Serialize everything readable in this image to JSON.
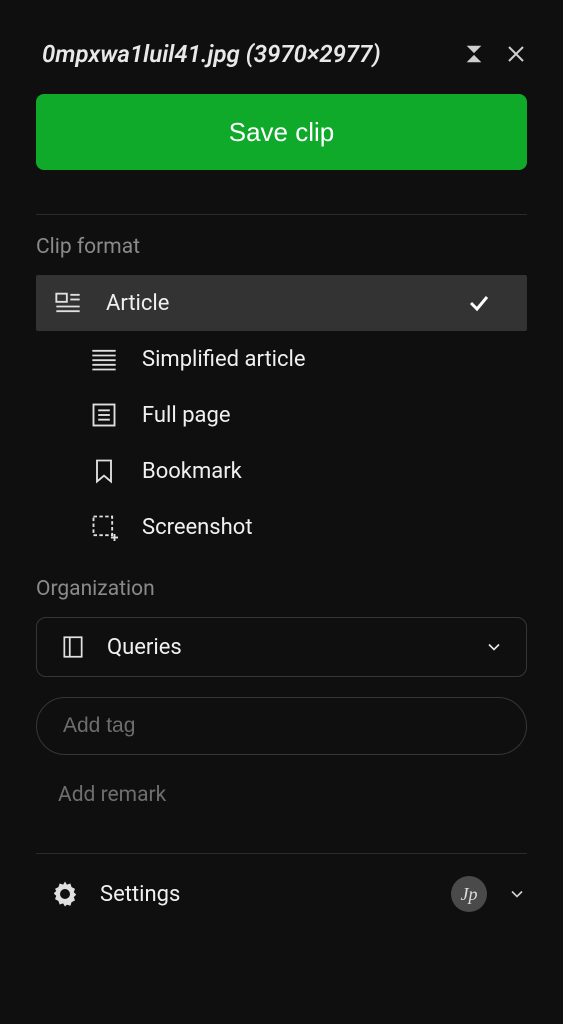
{
  "header": {
    "title": "0mpxwa1luil41.jpg (3970×2977)"
  },
  "save_button_label": "Save clip",
  "clip_format": {
    "section_label": "Clip format",
    "items": [
      {
        "label": "Article",
        "icon": "article",
        "selected": true
      },
      {
        "label": "Simplified article",
        "icon": "simplified",
        "selected": false
      },
      {
        "label": "Full page",
        "icon": "fullpage",
        "selected": false
      },
      {
        "label": "Bookmark",
        "icon": "bookmark",
        "selected": false
      },
      {
        "label": "Screenshot",
        "icon": "screenshot",
        "selected": false
      }
    ]
  },
  "organization": {
    "section_label": "Organization",
    "notebook": "Queries",
    "tag_placeholder": "Add tag",
    "remark_placeholder": "Add remark"
  },
  "footer": {
    "settings_label": "Settings",
    "avatar_initials": "Jp"
  }
}
